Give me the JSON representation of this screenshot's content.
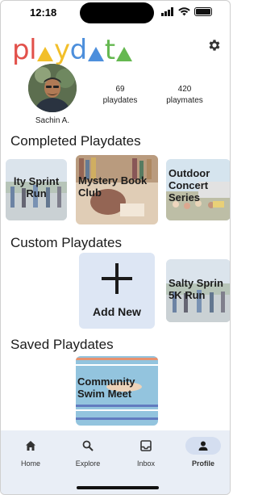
{
  "status_bar": {
    "time": "12:18"
  },
  "header": {
    "logo_letters": [
      "p",
      "l",
      "y",
      "d",
      "t",
      "e"
    ],
    "logo_text": "playdate",
    "colors": {
      "red": "#e2514b",
      "yellow": "#f2bf2a",
      "blue": "#4d8fdc",
      "green": "#65b850"
    },
    "settings_icon": "gear-icon"
  },
  "profile": {
    "name": "Sachin A.",
    "stats": [
      {
        "value": "69",
        "label": "playdates"
      },
      {
        "value": "420",
        "label": "playmates"
      }
    ]
  },
  "sections": {
    "completed": {
      "title": "Completed Playdates",
      "cards": [
        {
          "label": "lty Sprint Run"
        },
        {
          "label": "Mystery Book Club"
        },
        {
          "label": "Outdoor Concert Series"
        }
      ]
    },
    "custom": {
      "title": "Custom Playdates",
      "add_label": "Add New",
      "cards": [
        {
          "label": "Salty Sprin 5K Run"
        }
      ]
    },
    "saved": {
      "title": "Saved Playdates",
      "cards": [
        {
          "label": "Community Swim Meet"
        }
      ]
    }
  },
  "bottom_nav": {
    "items": [
      {
        "label": "Home",
        "icon": "home-icon"
      },
      {
        "label": "Explore",
        "icon": "search-icon"
      },
      {
        "label": "Inbox",
        "icon": "inbox-icon"
      },
      {
        "label": "Profile",
        "icon": "person-icon"
      }
    ],
    "active": "Profile"
  }
}
